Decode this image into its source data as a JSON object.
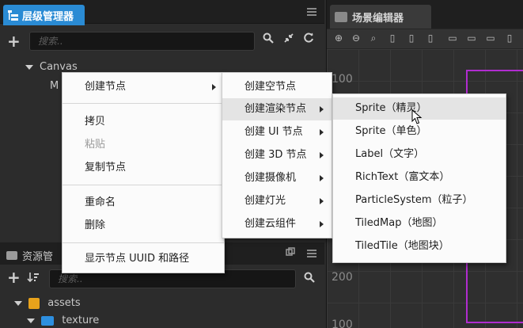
{
  "hierarchy": {
    "tab_title": "层级管理器",
    "search_placeholder": "搜索..",
    "tree": {
      "canvas": "Canvas",
      "child_partial": "M"
    }
  },
  "assets": {
    "tab_title": "资源管",
    "search_placeholder": "搜索..",
    "tree": {
      "root": "assets",
      "child": "texture"
    }
  },
  "scene": {
    "tab_title": "场景编辑器",
    "ruler_labels": [
      "100",
      "200",
      "100"
    ]
  },
  "context_menu": {
    "items": [
      {
        "label": "创建节点",
        "has_submenu": true
      },
      {
        "label": "拷贝"
      },
      {
        "label": "粘贴",
        "disabled": true
      },
      {
        "label": "复制节点"
      },
      {
        "label": "重命名"
      },
      {
        "label": "删除"
      },
      {
        "label": "显示节点 UUID 和路径"
      }
    ]
  },
  "create_submenu": {
    "items": [
      {
        "label": "创建空节点"
      },
      {
        "label": "创建渲染节点",
        "has_submenu": true,
        "highlighted": true
      },
      {
        "label": "创建 UI 节点",
        "has_submenu": true
      },
      {
        "label": "创建 3D 节点",
        "has_submenu": true
      },
      {
        "label": "创建摄像机",
        "has_submenu": true
      },
      {
        "label": "创建灯光",
        "has_submenu": true
      },
      {
        "label": "创建云组件",
        "has_submenu": true
      }
    ]
  },
  "render_submenu": {
    "items": [
      {
        "label": "Sprite（精灵）",
        "highlighted": true
      },
      {
        "label": "Sprite（单色）"
      },
      {
        "label": "Label（文字）"
      },
      {
        "label": "RichText（富文本）"
      },
      {
        "label": "ParticleSystem（粒子）"
      },
      {
        "label": "TiledMap（地图）"
      },
      {
        "label": "TiledTile（地图块）"
      }
    ]
  },
  "colors": {
    "active_tab": "#2a8bd4",
    "canvas_border": "#b02ccf",
    "asset_folder": "#e8a21b",
    "texture_folder": "#2d8fdf"
  }
}
